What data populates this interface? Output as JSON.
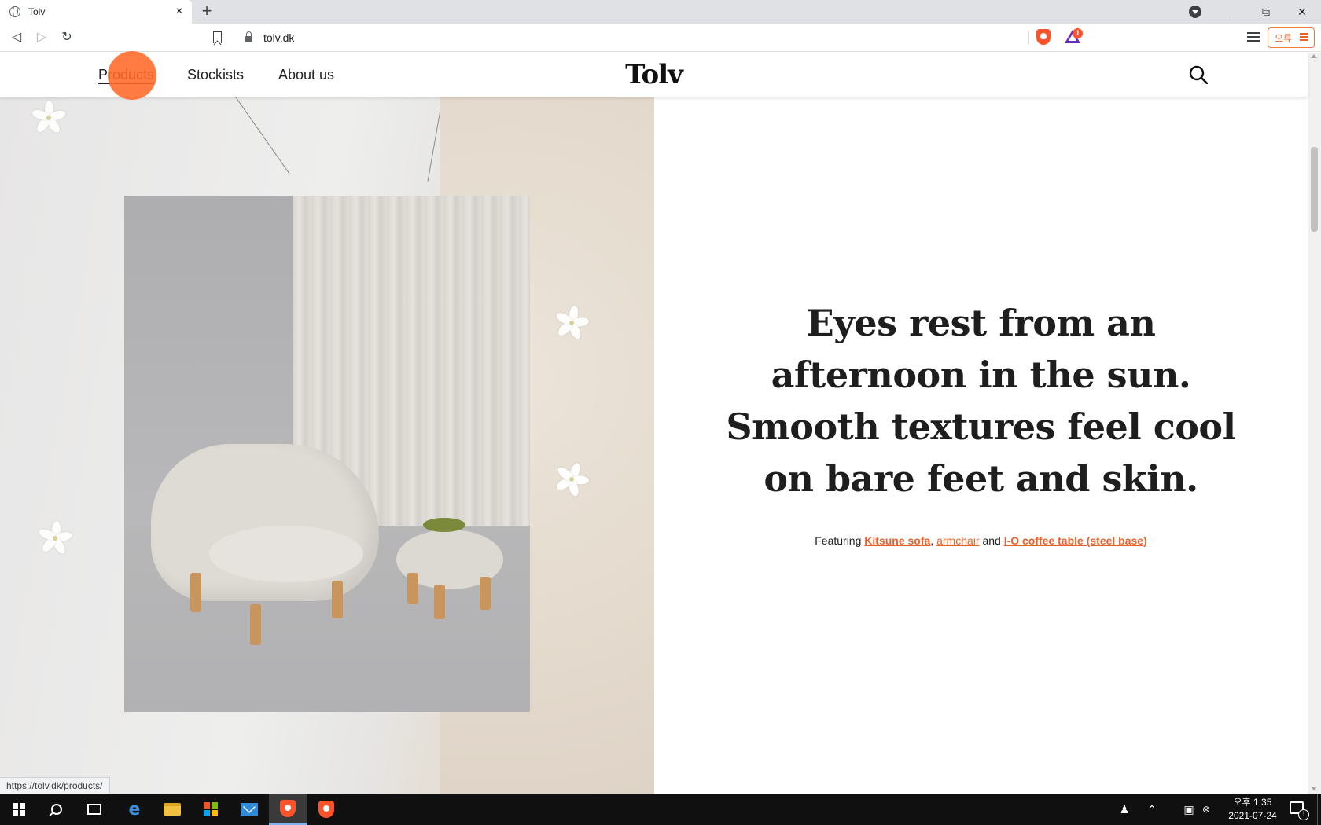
{
  "browser": {
    "tab_title": "Tolv",
    "new_tab_symbol": "+",
    "url": "tolv.dk",
    "rewards_badge": "1",
    "profile_label": "오류",
    "status_url": "https://tolv.dk/products/"
  },
  "site": {
    "logo": "Tolv",
    "nav": {
      "products": "Products",
      "stockists": "Stockists",
      "about": "About us"
    }
  },
  "hero": {
    "headline_lines": [
      "Eyes rest from an",
      "afternoon in the sun.",
      "Smooth textures feel cool",
      "on bare feet and skin."
    ],
    "featuring_prefix": "Featuring",
    "link_sofa": "Kitsune sofa",
    "separator": ",",
    "link_armchair": "armchair",
    "conjunction": "and",
    "link_table": "I-O coffee table (steel base)"
  },
  "taskbar": {
    "clock_time": "오후 1:35",
    "clock_date": "2021-07-24",
    "notification_count": "1"
  },
  "colors": {
    "accent": "#e8622c",
    "click_indicator": "#ff6928",
    "brave": "#fb542b"
  }
}
